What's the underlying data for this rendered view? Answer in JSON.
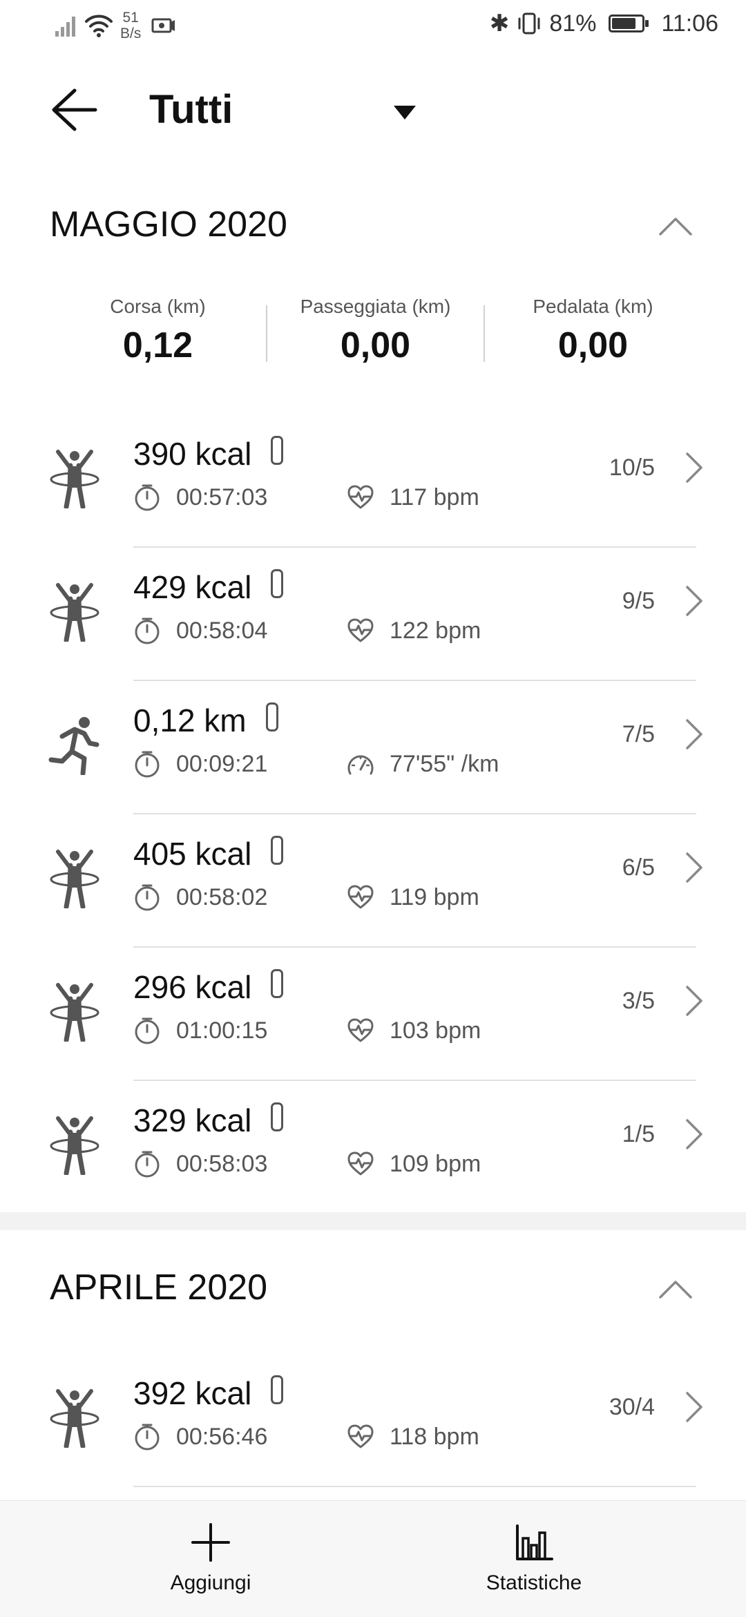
{
  "status_bar": {
    "net_speed_value": "51",
    "net_speed_unit": "B/s",
    "battery": "81%",
    "battery_level": 0.81,
    "time": "11:06"
  },
  "header": {
    "title": "Tutti"
  },
  "sections": [
    {
      "title": "MAGGIO 2020",
      "summary": [
        {
          "label": "Corsa (km)",
          "value": "0,12"
        },
        {
          "label": "Passeggiata (km)",
          "value": "0,00"
        },
        {
          "label": "Pedalata (km)",
          "value": "0,00"
        }
      ],
      "items": [
        {
          "type": "hula-hoop",
          "primary": "390 kcal",
          "duration": "00:57:03",
          "metric": "117 bpm",
          "metric_icon": "heart-rate-icon",
          "date": "10/5"
        },
        {
          "type": "hula-hoop",
          "primary": "429 kcal",
          "duration": "00:58:04",
          "metric": "122 bpm",
          "metric_icon": "heart-rate-icon",
          "date": "9/5"
        },
        {
          "type": "running",
          "primary": "0,12 km",
          "duration": "00:09:21",
          "metric": "77'55\" /km",
          "metric_icon": "pace-gauge-icon",
          "date": "7/5"
        },
        {
          "type": "hula-hoop",
          "primary": "405 kcal",
          "duration": "00:58:02",
          "metric": "119 bpm",
          "metric_icon": "heart-rate-icon",
          "date": "6/5"
        },
        {
          "type": "hula-hoop",
          "primary": "296 kcal",
          "duration": "01:00:15",
          "metric": "103 bpm",
          "metric_icon": "heart-rate-icon",
          "date": "3/5"
        },
        {
          "type": "hula-hoop",
          "primary": "329 kcal",
          "duration": "00:58:03",
          "metric": "109 bpm",
          "metric_icon": "heart-rate-icon",
          "date": "1/5"
        }
      ]
    },
    {
      "title": "APRILE 2020",
      "items": [
        {
          "type": "hula-hoop",
          "primary": "392 kcal",
          "duration": "00:56:46",
          "metric": "118 bpm",
          "metric_icon": "heart-rate-icon",
          "date": "30/4"
        }
      ]
    }
  ],
  "bottom_nav": {
    "add_label": "Aggiungi",
    "stats_label": "Statistiche"
  }
}
